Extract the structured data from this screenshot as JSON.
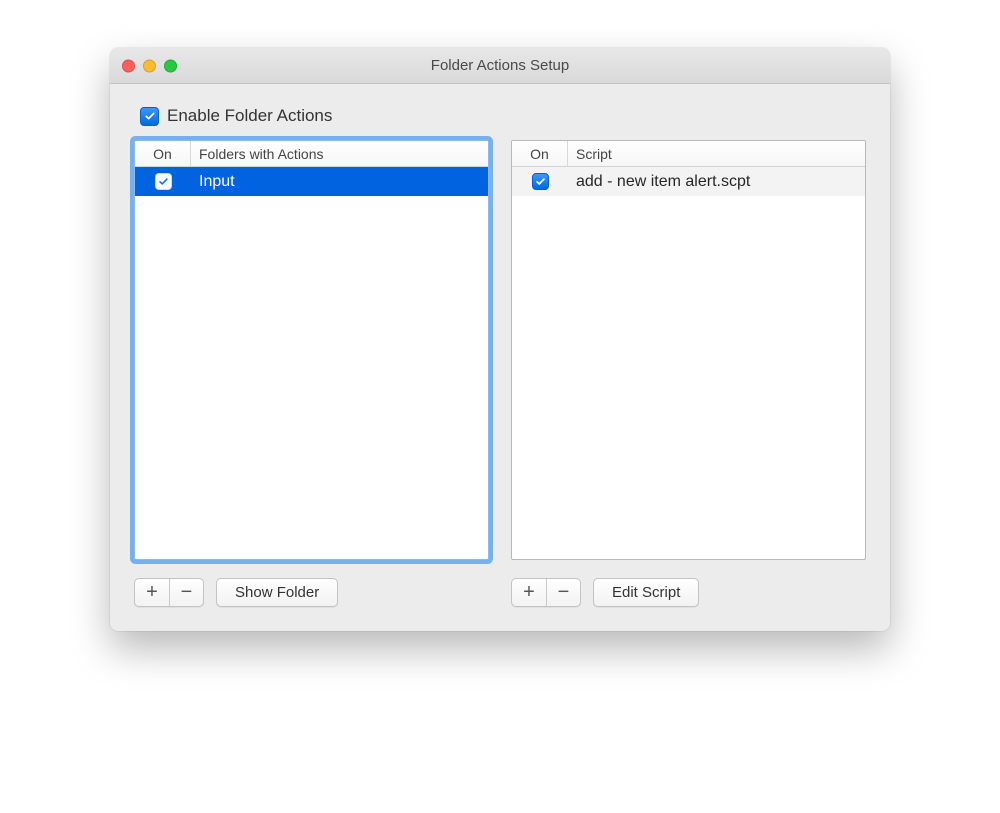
{
  "window": {
    "title": "Folder Actions Setup"
  },
  "enable": {
    "label": "Enable Folder Actions",
    "checked": true
  },
  "folders_pane": {
    "headers": {
      "on": "On",
      "name": "Folders with Actions"
    },
    "rows": [
      {
        "on": true,
        "name": "Input",
        "selected": true
      }
    ],
    "buttons": {
      "add": "+",
      "remove": "−",
      "show": "Show Folder"
    }
  },
  "scripts_pane": {
    "headers": {
      "on": "On",
      "name": "Script"
    },
    "rows": [
      {
        "on": true,
        "name": "add - new item alert.scpt",
        "selected": false
      }
    ],
    "buttons": {
      "add": "+",
      "remove": "−",
      "edit": "Edit Script"
    }
  }
}
